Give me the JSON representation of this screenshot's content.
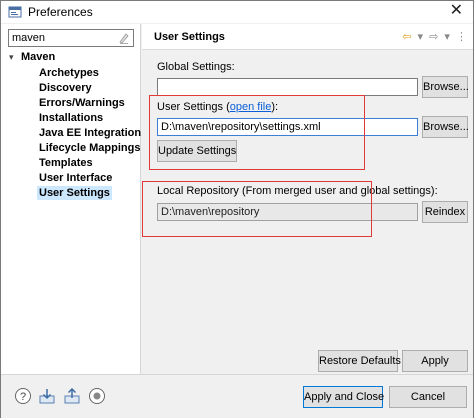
{
  "window": {
    "title": "Preferences",
    "close_glyph": "✕"
  },
  "filter": {
    "value": "maven",
    "clear_icon": "clear-filter-icon"
  },
  "tree": {
    "root": {
      "arrow": "▾",
      "label": "Maven"
    },
    "items": [
      {
        "label": "Archetypes"
      },
      {
        "label": "Discovery"
      },
      {
        "label": "Errors/Warnings"
      },
      {
        "label": "Installations"
      },
      {
        "label": "Java EE Integration"
      },
      {
        "label": "Lifecycle Mappings"
      },
      {
        "label": "Templates"
      },
      {
        "label": "User Interface"
      },
      {
        "label": "User Settings",
        "selected": true
      }
    ]
  },
  "page": {
    "title": "User Settings",
    "nav": {
      "back": "⇦",
      "back_menu": "▾",
      "forward": "⇨",
      "forward_menu": "▾",
      "menu": "⋮"
    }
  },
  "global_settings": {
    "label": "Global Settings:",
    "value": "",
    "browse_label": "Browse..."
  },
  "user_settings": {
    "label_prefix": "User Settings (",
    "link_text": "open file",
    "label_suffix": "):",
    "value": "D:\\maven\\repository\\settings.xml",
    "browse_label": "Browse...",
    "update_label": "Update Settings"
  },
  "local_repository": {
    "label": "Local Repository (From merged user and global settings):",
    "value": "D:\\maven\\repository",
    "reindex_label": "Reindex"
  },
  "actions": {
    "restore_defaults": "Restore Defaults",
    "apply": "Apply",
    "apply_and_close": "Apply and Close",
    "cancel": "Cancel"
  },
  "colors": {
    "highlight_box": "#e03a3a",
    "selection": "#cce8ff",
    "link": "#0a5fd8"
  }
}
